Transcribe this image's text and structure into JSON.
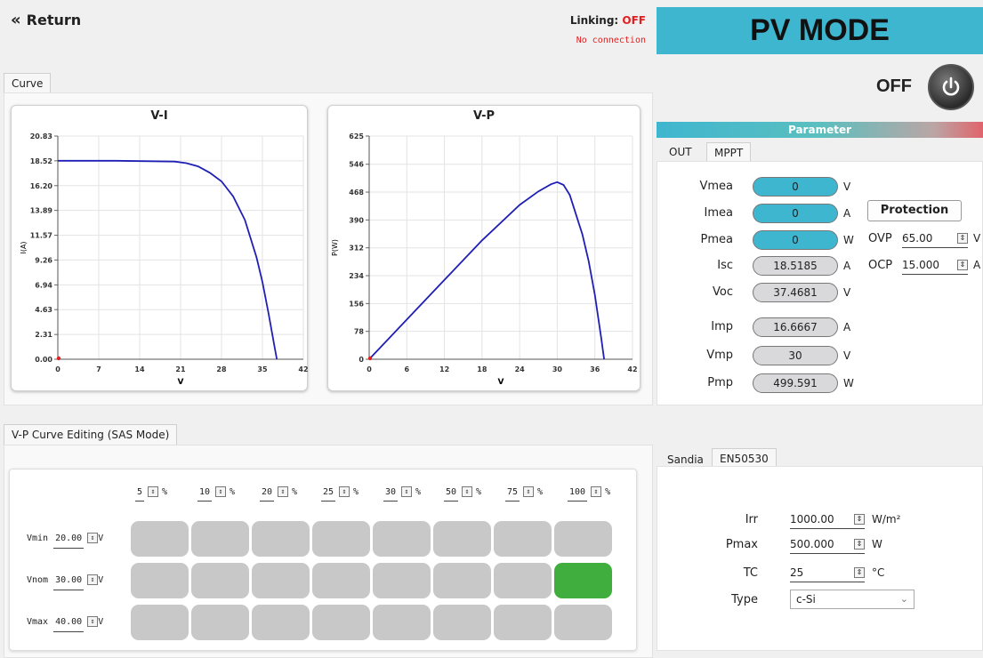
{
  "header": {
    "return_label": "Return",
    "linking_label": "Linking:",
    "linking_state": "OFF",
    "connection_status": "No connection",
    "mode_title": "PV MODE",
    "power_state": "OFF"
  },
  "curve_tab": "Curve",
  "charts": {
    "vi": {
      "title": "V-I",
      "xlabel": "V",
      "ylabel": "I(A)"
    },
    "vp": {
      "title": "V-P",
      "xlabel": "V",
      "ylabel": "P(W)"
    }
  },
  "chart_data": [
    {
      "type": "line",
      "title": "V-I",
      "xlabel": "V",
      "ylabel": "I(A)",
      "xlim": [
        0,
        42
      ],
      "ylim": [
        0,
        20.83
      ],
      "x_ticks": [
        "0",
        "7",
        "14",
        "21",
        "28",
        "35",
        "42"
      ],
      "y_ticks": [
        "0.00",
        "2.31",
        "4.63",
        "6.94",
        "9.26",
        "11.57",
        "13.89",
        "16.20",
        "18.52",
        "20.83"
      ],
      "grid": true,
      "series": [
        {
          "x": [
            0,
            10,
            20,
            22,
            24,
            26,
            28,
            30,
            32,
            34,
            35,
            36,
            37,
            37.47
          ],
          "y": [
            18.52,
            18.52,
            18.45,
            18.3,
            18.0,
            17.4,
            16.6,
            15.2,
            13.0,
            9.5,
            7.2,
            4.4,
            1.4,
            0
          ]
        }
      ],
      "color": "#1f1fb5"
    },
    {
      "type": "line",
      "title": "V-P",
      "xlabel": "V",
      "ylabel": "P(W)",
      "xlim": [
        0,
        42
      ],
      "ylim": [
        0,
        625
      ],
      "x_ticks": [
        "0",
        "6",
        "12",
        "18",
        "24",
        "30",
        "36",
        "42"
      ],
      "y_ticks": [
        "0",
        "78",
        "156",
        "234",
        "312",
        "390",
        "468",
        "546",
        "625"
      ],
      "grid": true,
      "series": [
        {
          "x": [
            0,
            6,
            12,
            18,
            24,
            27,
            29,
            30,
            31,
            32,
            34,
            35,
            36,
            37,
            37.47
          ],
          "y": [
            0,
            111,
            222,
            333,
            432,
            470,
            490,
            496,
            488,
            460,
            350,
            275,
            180,
            60,
            0
          ]
        }
      ],
      "color": "#1f1fb5"
    }
  ],
  "parameter": {
    "title": "Parameter",
    "tabs": [
      "OUT",
      "MPPT"
    ],
    "rows": [
      {
        "label": "Vmea",
        "value": "0",
        "unit": "V"
      },
      {
        "label": "Imea",
        "value": "0",
        "unit": "A"
      },
      {
        "label": "Pmea",
        "value": "0",
        "unit": "W"
      },
      {
        "label": "Isc",
        "value": "18.5185",
        "unit": "A"
      },
      {
        "label": "Voc",
        "value": "37.4681",
        "unit": "V"
      },
      {
        "label": "Imp",
        "value": "16.6667",
        "unit": "A"
      },
      {
        "label": "Vmp",
        "value": "30",
        "unit": "V"
      },
      {
        "label": "Pmp",
        "value": "499.591",
        "unit": "W"
      }
    ],
    "protection": {
      "button": "Protection",
      "ovp_label": "OVP",
      "ovp_value": "65.00",
      "ovp_unit": "V",
      "ocp_label": "OCP",
      "ocp_value": "15.000",
      "ocp_unit": "A"
    }
  },
  "sas": {
    "tab": "V-P Curve Editing (SAS Mode)",
    "percents": [
      "5",
      "10",
      "20",
      "25",
      "30",
      "50",
      "75",
      "100"
    ],
    "percent_unit": "%",
    "rows": [
      {
        "label": "Vmin",
        "value": "20.00",
        "unit": "V"
      },
      {
        "label": "Vnom",
        "value": "30.00",
        "unit": "V"
      },
      {
        "label": "Vmax",
        "value": "40.00",
        "unit": "V"
      }
    ],
    "active_cell": {
      "row": 1,
      "col": 7
    }
  },
  "standards": {
    "tabs": [
      "Sandia",
      "EN50530"
    ],
    "fields": [
      {
        "label": "Irr",
        "value": "1000.00",
        "unit": "W/m²"
      },
      {
        "label": "Pmax",
        "value": "500.000",
        "unit": "W"
      },
      {
        "label": "TC",
        "value": "25",
        "unit": "°C"
      }
    ],
    "type_label": "Type",
    "type_value": "c-Si"
  },
  "colors": {
    "accent": "#3fb6cf",
    "alert": "#e31e1e",
    "active": "#3fae3f",
    "curve": "#1f1fb5"
  }
}
